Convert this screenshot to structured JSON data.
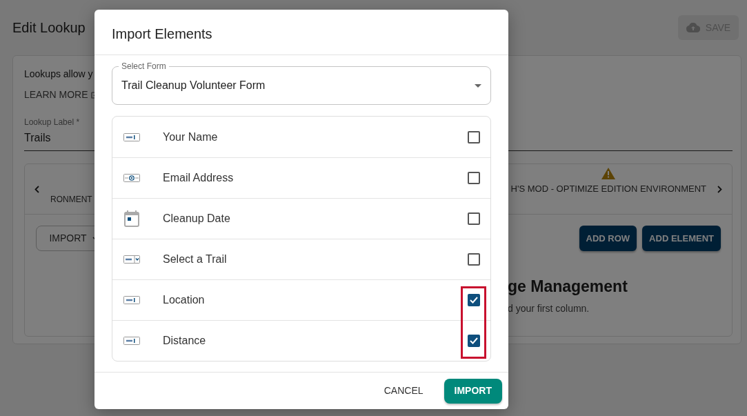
{
  "page": {
    "title": "Edit Lookup",
    "save_button": {
      "label": "SAVE",
      "disabled": true
    },
    "intro": "Lookups allow y",
    "learn_more": "LEARN MORE",
    "lookup_label": {
      "label": "Lookup Label *",
      "value": "Trails"
    },
    "tabs": [
      {
        "label": "RONMENT",
        "warning": false
      },
      {
        "label": "H'S MOD - OPTIMIZE EDITION ENVIRONMENT",
        "warning": true
      }
    ],
    "import_menu": "IMPORT",
    "buttons": [
      "ADD ROW",
      "ADD ELEMENT"
    ],
    "empty_title": "ge Management",
    "empty_text": "d your first column."
  },
  "dialog": {
    "title": "Import Elements",
    "select": {
      "label": "Select Form",
      "value": "Trail Cleanup Volunteer Form"
    },
    "elements": [
      {
        "kind": "text",
        "label": "Your Name",
        "checked": false,
        "highlighted": false
      },
      {
        "kind": "email",
        "label": "Email Address",
        "checked": false,
        "highlighted": false
      },
      {
        "kind": "date",
        "label": "Cleanup Date",
        "checked": false,
        "highlighted": false
      },
      {
        "kind": "dropdown",
        "label": "Select a Trail",
        "checked": false,
        "highlighted": false
      },
      {
        "kind": "text",
        "label": "Location",
        "checked": true,
        "highlighted": true
      },
      {
        "kind": "text",
        "label": "Distance",
        "checked": true,
        "highlighted": true
      }
    ],
    "actions": [
      {
        "kind": "text",
        "label": "CANCEL"
      },
      {
        "kind": "primary",
        "label": "IMPORT"
      }
    ]
  }
}
